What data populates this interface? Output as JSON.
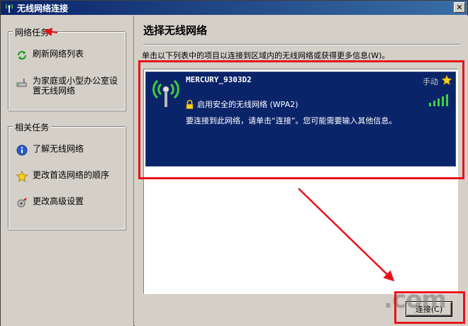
{
  "window": {
    "title": "无线网络连接",
    "close_glyph": "✕"
  },
  "left_pane": {
    "network_tasks": {
      "title": "网络任务",
      "items": [
        {
          "label": "刷新网络列表",
          "icon": "refresh-icon"
        },
        {
          "label": "为家庭或小型办公室设置无线网络",
          "icon": "wireless-setup-icon"
        }
      ]
    },
    "related_tasks": {
      "title": "相关任务",
      "items": [
        {
          "label": "了解无线网络",
          "icon": "info-icon"
        },
        {
          "label": "更改首选网络的顺序",
          "icon": "star-icon"
        },
        {
          "label": "更改高级设置",
          "icon": "settings-icon"
        }
      ]
    }
  },
  "main": {
    "title": "选择无线网络",
    "instruction": "单击以下列表中的项目以连接到区域内的无线网络或获得更多信息(W)。",
    "networks": [
      {
        "ssid": "MERCURY_9303D2",
        "mode": "手动",
        "security": "启用安全的无线网络 (WPA2)",
        "description": "要连接到此网络，请单击“连接”。您可能需要输入其他信息。",
        "signal_bars": 5
      }
    ],
    "connect_button": "连接(C)"
  },
  "watermark": ".com",
  "colors": {
    "titlebar": "#0a246a",
    "selection": "#0a246a",
    "annotation": "#e8121c"
  }
}
